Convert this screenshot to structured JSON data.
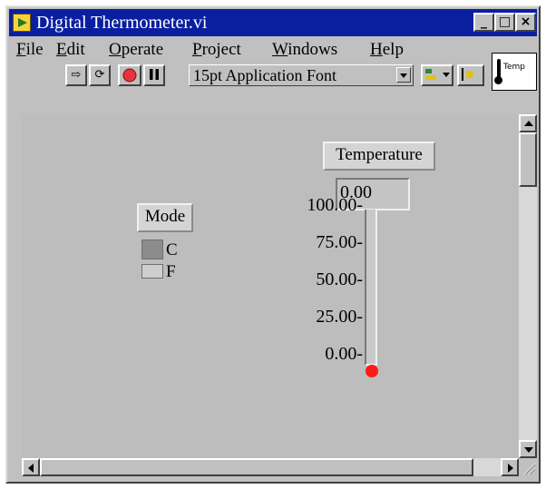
{
  "window": {
    "title": "Digital Thermometer.vi",
    "buttons": {
      "minimize": "_",
      "maximize": "□",
      "close": "×"
    }
  },
  "menubar": [
    {
      "label": "File",
      "ul": "F",
      "rest": "ile"
    },
    {
      "label": "Edit",
      "ul": "E",
      "rest": "dit"
    },
    {
      "label": "Operate",
      "ul": "O",
      "rest": "perate"
    },
    {
      "label": "Project",
      "ul": "P",
      "rest": "roject"
    },
    {
      "label": "Windows",
      "ul": "W",
      "rest": "indows"
    },
    {
      "label": "Help",
      "ul": "H",
      "rest": "elp"
    }
  ],
  "toolbar": {
    "run_icon": "⇨",
    "continuous_run_icon": "⟳",
    "font_ring_value": "15pt Application Font"
  },
  "vi_icon": {
    "label": "Temp"
  },
  "front_panel": {
    "thermometer": {
      "label": "Temperature",
      "value_display": "0.00",
      "ticks": [
        "100.00-",
        "75.00-",
        "50.00-",
        "25.00-",
        "0.00-"
      ],
      "scale_min": 0,
      "scale_max": 100,
      "value": 0,
      "fill_color": "#ff1a1a"
    },
    "mode": {
      "label": "Mode",
      "options": [
        "C",
        "F"
      ],
      "selected": "C"
    }
  }
}
